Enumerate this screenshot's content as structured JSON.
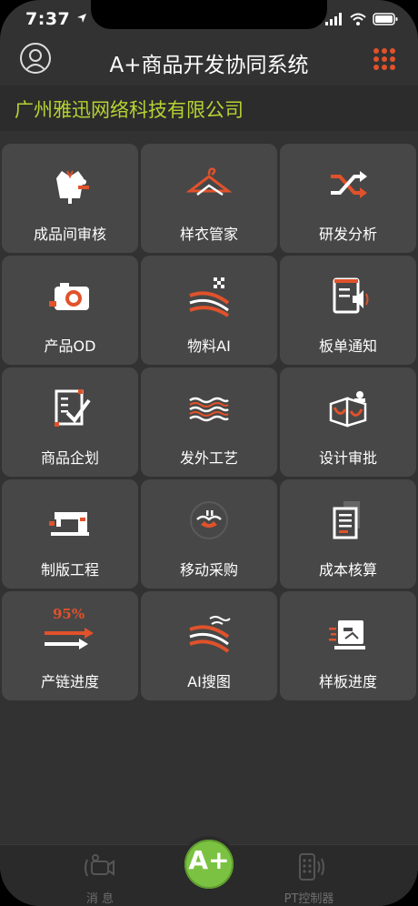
{
  "status": {
    "time": "7:37"
  },
  "header": {
    "title": "A+商品开发协同系统"
  },
  "company": "广州雅迅网络科技有限公司",
  "tiles": [
    {
      "label": "成品间审核",
      "icon": "tailor-bust-icon"
    },
    {
      "label": "样衣管家",
      "icon": "hanger-icon"
    },
    {
      "label": "研发分析",
      "icon": "shuffle-icon"
    },
    {
      "label": "产品OD",
      "icon": "camera-icon"
    },
    {
      "label": "物料AI",
      "icon": "fabric-swatch-icon"
    },
    {
      "label": "板单通知",
      "icon": "notice-speaker-icon"
    },
    {
      "label": "商品企划",
      "icon": "checklist-icon"
    },
    {
      "label": "发外工艺",
      "icon": "knit-fabric-icon"
    },
    {
      "label": "设计审批",
      "icon": "design-approval-icon"
    },
    {
      "label": "制版工程",
      "icon": "sewing-machine-icon"
    },
    {
      "label": "移动采购",
      "icon": "mobile-purchase-icon"
    },
    {
      "label": "成本核算",
      "icon": "cost-document-icon"
    },
    {
      "label": "产链进度",
      "icon": "progress-arrow-icon",
      "value": "95%"
    },
    {
      "label": "AI搜图",
      "icon": "fabric-search-icon"
    },
    {
      "label": "样板进度",
      "icon": "sample-machine-icon"
    }
  ],
  "bottom": {
    "tabs": [
      {
        "label": "消 息"
      },
      {
        "label": "A+"
      },
      {
        "label": "PT控制器"
      }
    ]
  },
  "colors": {
    "accent": "#e0522b",
    "brand_green": "#b6d332",
    "fab_green": "#7cc242"
  }
}
